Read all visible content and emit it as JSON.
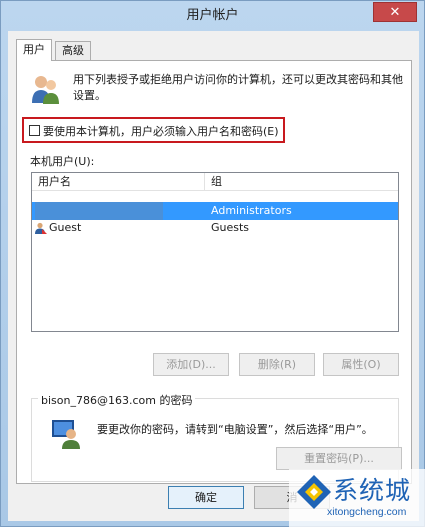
{
  "window": {
    "title": "用户帐户",
    "close_label": "✕"
  },
  "tabs": [
    {
      "label": "用户"
    },
    {
      "label": "高级"
    }
  ],
  "panel": {
    "description": "用下列表授予或拒绝用户访问你的计算机，还可以更改其密码和其他设置。",
    "require_checkbox": {
      "label": "要使用本计算机，用户必须输入用户名和密码(E)",
      "checked": false
    },
    "users_label": "本机用户(U):",
    "table": {
      "columns": [
        "用户名",
        "组"
      ],
      "rows": [
        {
          "name": "",
          "group": "Administrators",
          "selected": true
        },
        {
          "name": "Guest",
          "group": "Guests",
          "selected": false
        }
      ]
    },
    "buttons": {
      "add": "添加(D)...",
      "remove": "删除(R)",
      "properties": "属性(O)"
    },
    "password_group": {
      "legend": "bison_786@163.com 的密码",
      "text": "要更改你的密码，请转到“电脑设置”，然后选择“用户”。",
      "reset_button": "重置密码(P)..."
    }
  },
  "footer": {
    "ok": "确定",
    "cancel": "消"
  },
  "watermark": {
    "name": "系统城",
    "url": "xitongcheng.com"
  },
  "colors": {
    "selection": "#3399ff",
    "highlight_border": "#c8191e",
    "titlebar": "#bcd6ef",
    "close": "#c7494a"
  },
  "icons": [
    "users-icon",
    "guest-user-icon",
    "user-password-icon",
    "watermark-logo-icon"
  ]
}
